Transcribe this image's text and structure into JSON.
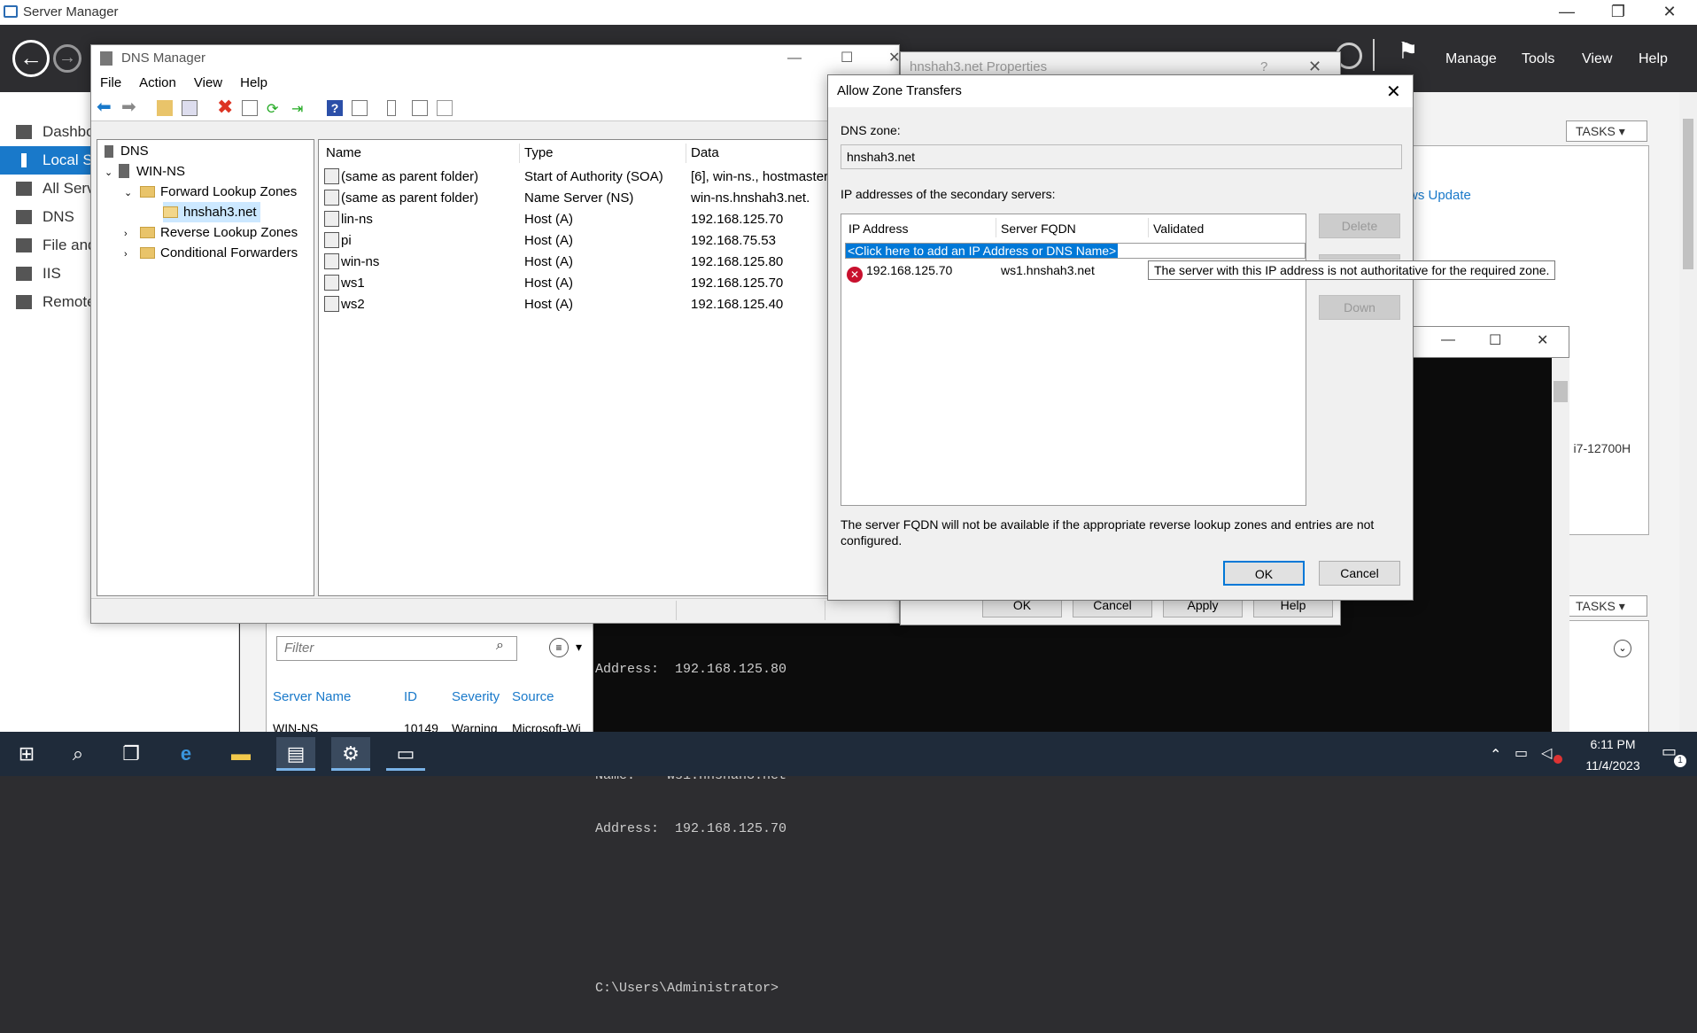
{
  "server_manager": {
    "title": "Server Manager",
    "menu": [
      "Manage",
      "Tools",
      "View",
      "Help"
    ],
    "sidebar": [
      {
        "label": "Dashbo",
        "selected": false
      },
      {
        "label": "Local S",
        "selected": true
      },
      {
        "label": "All Serv",
        "selected": false
      },
      {
        "label": "DNS",
        "selected": false
      },
      {
        "label": "File and",
        "selected": false
      },
      {
        "label": "IIS",
        "selected": false
      },
      {
        "label": "Remote",
        "selected": false
      }
    ],
    "tasks_label": "TASKS",
    "update_link": "ws Update",
    "cpu_text": ") i7-12700H",
    "filter_placeholder": "Filter",
    "events_columns": [
      "Server Name",
      "ID",
      "Severity",
      "Source"
    ],
    "events_row": [
      "WIN-NS",
      "10149",
      "Warning",
      "Microsoft-Wi"
    ]
  },
  "console": {
    "lines": [
      "Address:  192.168.125.80",
      "",
      "Name:    ws1.hnshah3.net",
      "Address:  192.168.125.70",
      "",
      "",
      "C:\\Users\\Administrator>"
    ]
  },
  "dns_manager": {
    "title": "DNS Manager",
    "menu": [
      "File",
      "Action",
      "View",
      "Help"
    ],
    "tree": {
      "root": "DNS",
      "server": "WIN-NS",
      "forward": "Forward Lookup Zones",
      "zone": "hnshah3.net",
      "reverse": "Reverse Lookup Zones",
      "conditional": "Conditional Forwarders"
    },
    "columns": [
      "Name",
      "Type",
      "Data"
    ],
    "records": [
      {
        "name": "(same as parent folder)",
        "type": "Start of Authority (SOA)",
        "data": "[6], win-ns., hostmaster."
      },
      {
        "name": "(same as parent folder)",
        "type": "Name Server (NS)",
        "data": "win-ns.hnshah3.net."
      },
      {
        "name": "lin-ns",
        "type": "Host (A)",
        "data": "192.168.125.70"
      },
      {
        "name": "pi",
        "type": "Host (A)",
        "data": "192.168.75.53"
      },
      {
        "name": "win-ns",
        "type": "Host (A)",
        "data": "192.168.125.80"
      },
      {
        "name": "ws1",
        "type": "Host (A)",
        "data": "192.168.125.70"
      },
      {
        "name": "ws2",
        "type": "Host (A)",
        "data": "192.168.125.40"
      }
    ]
  },
  "properties": {
    "title": "hnshah3.net Properties",
    "help_glyph": "?",
    "buttons": [
      "OK",
      "Cancel",
      "Apply",
      "Help"
    ]
  },
  "allow_zone": {
    "title": "Allow Zone Transfers",
    "dns_zone_label": "DNS zone:",
    "dns_zone_value": "hnshah3.net",
    "ip_label": "IP addresses of the secondary servers:",
    "columns": [
      "IP Address",
      "Server FQDN",
      "Validated"
    ],
    "add_row": "<Click here to add an IP Address or DNS Name>",
    "entries": [
      {
        "ip": "192.168.125.70",
        "fqdn": "ws1.hnshah3.net"
      }
    ],
    "tooltip": "The server with this IP address is not authoritative for the required zone.",
    "delete_label": "Delete",
    "down_label": "Down",
    "note": "The server FQDN will not be available if the appropriate reverse lookup zones and entries are not configured.",
    "ok_label": "OK",
    "cancel_label": "Cancel"
  },
  "taskbar": {
    "time": "6:11 PM",
    "date": "11/4/2023",
    "notification_count": "1"
  }
}
